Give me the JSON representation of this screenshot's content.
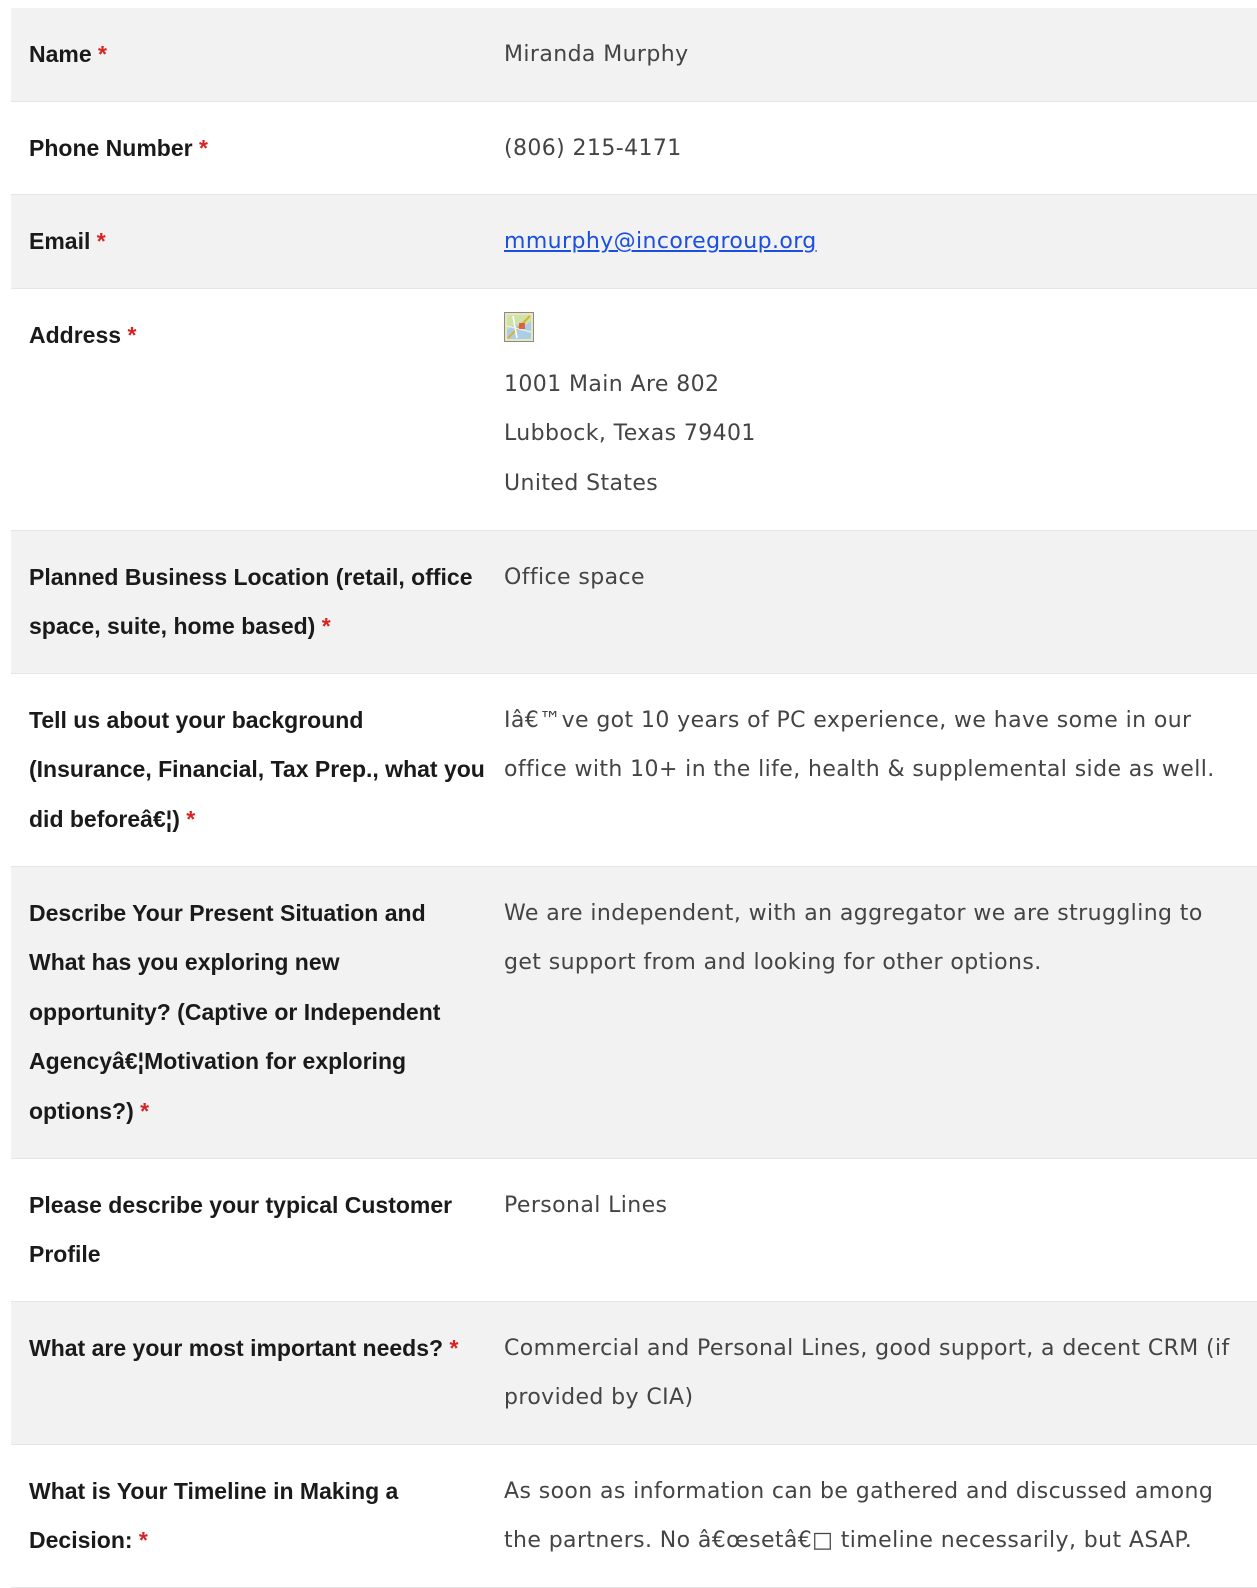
{
  "required_marker": "*",
  "rows": [
    {
      "label": "Name",
      "required": true,
      "value": "Miranda Murphy"
    },
    {
      "label": "Phone Number",
      "required": true,
      "value": "(806) 215-4171"
    },
    {
      "label": "Email",
      "required": true,
      "value": "mmurphy@incoregroup.org"
    },
    {
      "label": "Address",
      "required": true,
      "icon": "map-icon",
      "address_lines": [
        "1001 Main Are 802",
        "Lubbock, Texas 79401",
        "United States"
      ]
    },
    {
      "label": "Planned Business Location (retail, office space, suite, home based)",
      "required": true,
      "value": "Office space"
    },
    {
      "label": "Tell us about your background (Insurance, Financial, Tax Prep., what you did beforeâ€¦)",
      "required": true,
      "value": "Iâ€™ve got 10 years of PC experience, we have some in our office with 10+ in the life, health & supplemental side as well."
    },
    {
      "label": "Describe Your Present Situation and What has you exploring new opportunity? (Captive or Independent Agencyâ€¦Motivation for exploring options?)",
      "required": true,
      "value": "We are independent, with an aggregator we are struggling to get support from and looking for other options."
    },
    {
      "label": "Please describe your typical Customer Profile",
      "required": false,
      "value": "Personal Lines"
    },
    {
      "label": "What are your most important needs?",
      "required": true,
      "value": "Commercial and Personal Lines, good support, a decent CRM (if provided by CIA)"
    },
    {
      "label": "What is Your Timeline in Making a Decision:",
      "required": true,
      "value": "As soon as information can be gathered and discussed among the partners. No â€œsetâ€□ timeline necessarily, but ASAP."
    }
  ],
  "colors": {
    "row_shade": "#f2f2f2",
    "required": "#d82323",
    "link": "#1a4fe0"
  }
}
